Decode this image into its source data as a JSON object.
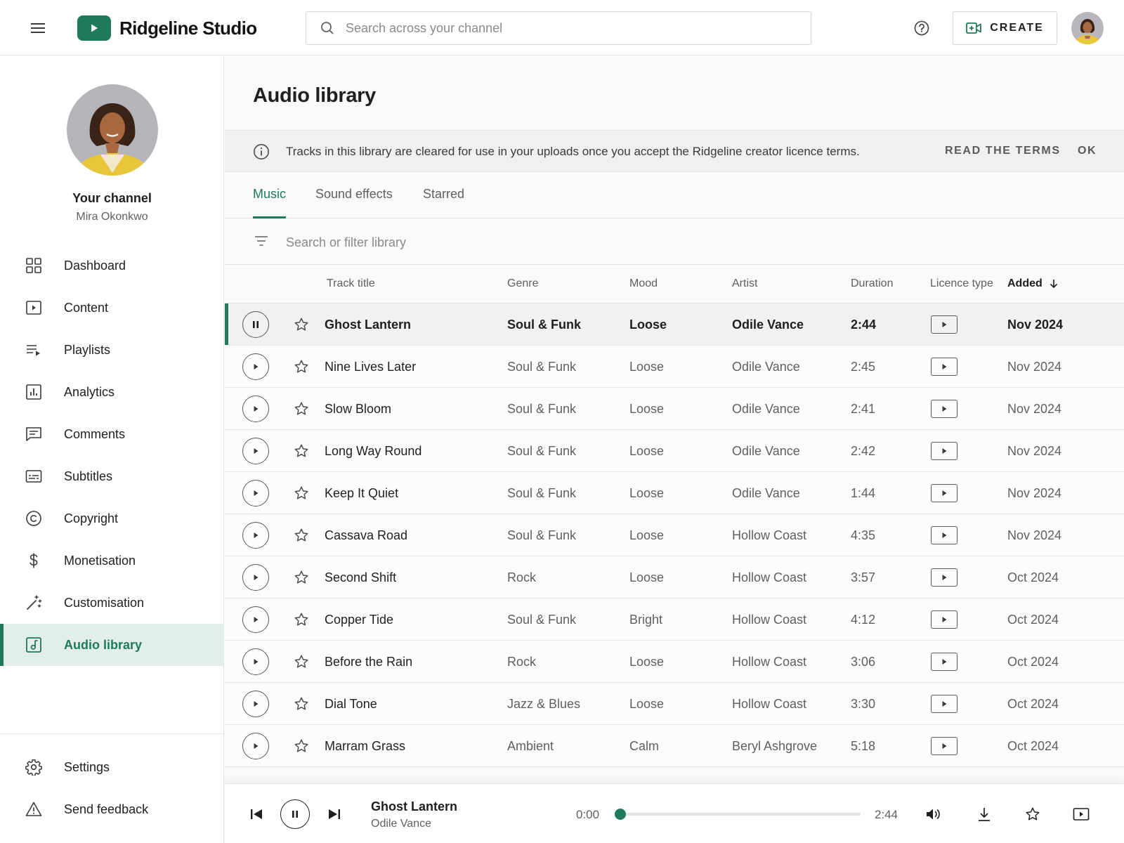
{
  "app": {
    "name": "Ridgeline Studio"
  },
  "header": {
    "search_placeholder": "Search across your channel",
    "create_label": "CREATE"
  },
  "sidebar": {
    "channel_label": "Your channel",
    "channel_owner": "Mira Okonkwo",
    "items": [
      {
        "label": "Dashboard",
        "icon": "dashboard-icon"
      },
      {
        "label": "Content",
        "icon": "content-icon"
      },
      {
        "label": "Playlists",
        "icon": "playlists-icon"
      },
      {
        "label": "Analytics",
        "icon": "analytics-icon"
      },
      {
        "label": "Comments",
        "icon": "comments-icon"
      },
      {
        "label": "Subtitles",
        "icon": "subtitles-icon"
      },
      {
        "label": "Copyright",
        "icon": "copyright-icon"
      },
      {
        "label": "Monetisation",
        "icon": "dollar-icon"
      },
      {
        "label": "Customisation",
        "icon": "magic-wand-icon"
      },
      {
        "label": "Audio library",
        "icon": "audio-library-icon",
        "active": true
      }
    ],
    "bottom_items": [
      {
        "label": "Settings",
        "icon": "gear-icon"
      },
      {
        "label": "Send feedback",
        "icon": "warning-icon"
      }
    ]
  },
  "main": {
    "title": "Audio library",
    "banner": {
      "text": "Tracks in this library are cleared for use in your uploads once you accept the Ridgeline creator licence terms.",
      "read_terms": "READ THE TERMS",
      "ok": "OK"
    },
    "tabs": [
      {
        "label": "Music",
        "active": true
      },
      {
        "label": "Sound effects"
      },
      {
        "label": "Starred"
      }
    ],
    "filter_placeholder": "Search or filter library",
    "columns": {
      "title": "Track title",
      "genre": "Genre",
      "mood": "Mood",
      "artist": "Artist",
      "duration": "Duration",
      "licence": "Licence type",
      "added": "Added"
    },
    "rows": [
      {
        "title": "Ghost Lantern",
        "genre": "Soul & Funk",
        "mood": "Loose",
        "artist": "Odile Vance",
        "duration": "2:44",
        "added": "Nov 2024",
        "playing": true
      },
      {
        "title": "Nine Lives Later",
        "genre": "Soul & Funk",
        "mood": "Loose",
        "artist": "Odile Vance",
        "duration": "2:45",
        "added": "Nov 2024"
      },
      {
        "title": "Slow Bloom",
        "genre": "Soul & Funk",
        "mood": "Loose",
        "artist": "Odile Vance",
        "duration": "2:41",
        "added": "Nov 2024"
      },
      {
        "title": "Long Way Round",
        "genre": "Soul & Funk",
        "mood": "Loose",
        "artist": "Odile Vance",
        "duration": "2:42",
        "added": "Nov 2024"
      },
      {
        "title": "Keep It Quiet",
        "genre": "Soul & Funk",
        "mood": "Loose",
        "artist": "Odile Vance",
        "duration": "1:44",
        "added": "Nov 2024"
      },
      {
        "title": "Cassava Road",
        "genre": "Soul & Funk",
        "mood": "Loose",
        "artist": "Hollow Coast",
        "duration": "4:35",
        "added": "Nov 2024"
      },
      {
        "title": "Second Shift",
        "genre": "Rock",
        "mood": "Loose",
        "artist": "Hollow Coast",
        "duration": "3:57",
        "added": "Oct 2024"
      },
      {
        "title": "Copper Tide",
        "genre": "Soul & Funk",
        "mood": "Bright",
        "artist": "Hollow Coast",
        "duration": "4:12",
        "added": "Oct 2024"
      },
      {
        "title": "Before the Rain",
        "genre": "Rock",
        "mood": "Loose",
        "artist": "Hollow Coast",
        "duration": "3:06",
        "added": "Oct 2024"
      },
      {
        "title": "Dial Tone",
        "genre": "Jazz & Blues",
        "mood": "Loose",
        "artist": "Hollow Coast",
        "duration": "3:30",
        "added": "Oct 2024"
      },
      {
        "title": "Marram Grass",
        "genre": "Ambient",
        "mood": "Calm",
        "artist": "Beryl Ashgrove",
        "duration": "5:18",
        "added": "Oct 2024"
      }
    ]
  },
  "player": {
    "title": "Ghost Lantern",
    "artist": "Odile Vance",
    "elapsed": "0:00",
    "total": "2:44",
    "progress": 0.01
  },
  "colors": {
    "accent": "#1f7a5c",
    "active_bg": "#e2eeea"
  }
}
